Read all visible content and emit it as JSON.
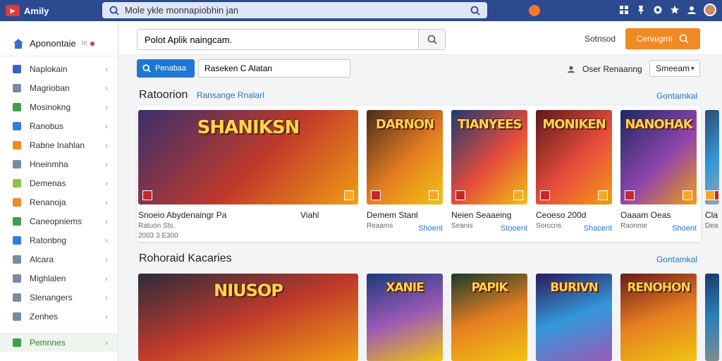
{
  "topbar": {
    "brand_name": "Amily",
    "search_value": "Mole ykle monnapiobhin jan"
  },
  "sidebar": {
    "title": "Aponontaie",
    "items": [
      {
        "label": "Naplokain",
        "icon": "puzzle-icon",
        "color": "#3c5fc2"
      },
      {
        "label": "Magrioban",
        "icon": "grid-icon",
        "color": "#7a8aa0"
      },
      {
        "label": "Mosinokng",
        "icon": "card-icon",
        "color": "#3aa04a"
      },
      {
        "label": "Ranobus",
        "icon": "share-icon",
        "color": "#2f7fe0"
      },
      {
        "label": "Rabne Inahlan",
        "icon": "tag-icon",
        "color": "#f08a24"
      },
      {
        "label": "Hneinmha",
        "icon": "box-icon",
        "color": "#7a8aa0"
      },
      {
        "label": "Demenas",
        "icon": "target-icon",
        "color": "#8bc34a"
      },
      {
        "label": "Renanoja",
        "icon": "flag-icon",
        "color": "#f08a24"
      },
      {
        "label": "Caneopniems",
        "icon": "leaf-icon",
        "color": "#3aa04a"
      },
      {
        "label": "Ratonbng",
        "icon": "pencil-icon",
        "color": "#2f7fe0"
      },
      {
        "label": "Alcara",
        "icon": "circle-icon",
        "color": "#7a8aa0"
      },
      {
        "label": "Mighlalen",
        "icon": "settings-icon",
        "color": "#7a8aa0"
      },
      {
        "label": "Slenangers",
        "icon": "layers-icon",
        "color": "#7a8aa0"
      },
      {
        "label": "Zenhes",
        "icon": "doc-icon",
        "color": "#7a8aa0"
      },
      {
        "label": "Pemnnes",
        "icon": "store-icon",
        "color": "#3aa04a"
      }
    ]
  },
  "main": {
    "search_value": "Polot Aplik naingcam.",
    "sort_label": "Sotnsod",
    "orange_button": "Cenaigml",
    "filter_chip": "Penabaa",
    "filter_value": "Raseken C Alatan",
    "right_label": "Oser Renaanng",
    "select_value": "Smeeam",
    "section1": {
      "title": "Ratoorion",
      "subtitle": "Ransange Rnalarl",
      "link": "Gontamkal"
    },
    "section2": {
      "title": "Rohoraid Kacaries",
      "link": "Gontamkal"
    },
    "cards_row1": [
      {
        "art_title": "SHANIKSN",
        "name": "Snoeio Abydenaingr Pa",
        "meta": "Ratuon Sts.",
        "meta2": "2003 3 E300",
        "extra": "Viahl",
        "price": ""
      },
      {
        "art_title": "DARNON",
        "name": "Demem Stanl",
        "meta": "Reaams",
        "extra": "",
        "price": "Shoent"
      },
      {
        "art_title": "TIANYEES",
        "name": "Neien Seaaeing",
        "meta": "Seanis",
        "extra": "",
        "price": "Stooent"
      },
      {
        "art_title": "MONIKEN",
        "name": "Ceoeso 200d",
        "meta": "Sorccns",
        "extra": "",
        "price": "Shacent"
      },
      {
        "art_title": "NANOHAK",
        "name": "Oaaam Oeas",
        "meta": "Raonme",
        "extra": "",
        "price": "Shoent"
      },
      {
        "art_title": "",
        "name": "Cla",
        "meta": "Dea",
        "extra": "",
        "price": ""
      }
    ],
    "cards_row2": [
      {
        "art_title": "NIUSOP"
      },
      {
        "art_title": "XANIE"
      },
      {
        "art_title": "PAPIK"
      },
      {
        "art_title": "BURIVN"
      },
      {
        "art_title": "RENOHON"
      },
      {
        "art_title": ""
      }
    ]
  }
}
